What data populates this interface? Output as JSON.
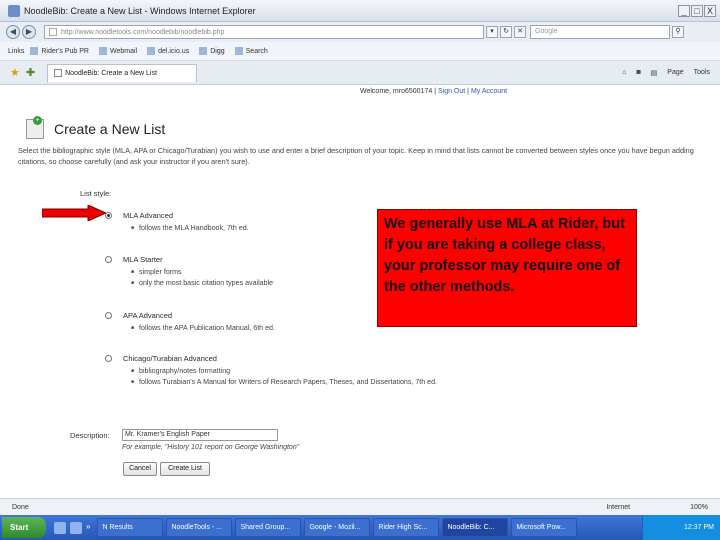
{
  "window": {
    "title": "NoodleBib: Create a New List - Windows Internet Explorer",
    "controls": [
      "_",
      "□",
      "X"
    ]
  },
  "address": {
    "url": "http://www.noodletools.com/noodlebib/noodlebib.php",
    "search_placeholder": "Google"
  },
  "links_bar": {
    "label": "Links",
    "items": [
      "Rider's Pub PR",
      "Webmail",
      "del.icio.us",
      "Digg",
      "Search"
    ]
  },
  "tab": {
    "label": "NoodleBib: Create a New List"
  },
  "toolbar_tools": [
    "Page",
    "Tools"
  ],
  "page": {
    "welcome_text": "Welcome, mro6500174",
    "sign_out": "Sign Out",
    "my_account": "My Account",
    "title": "Create a New List",
    "intro": "Select the bibliographic style (MLA, APA or Chicago/Turabian) you wish to use and enter a brief description of your topic. Keep in mind that lists cannot be converted between styles once you have begun adding citations, so choose carefully (and ask your instructor if you aren't sure).",
    "list_style_label": "List style:",
    "options": [
      {
        "name": "MLA Advanced",
        "selected": true,
        "bullets": [
          "follows the MLA Handbook, 7th ed."
        ]
      },
      {
        "name": "MLA Starter",
        "selected": false,
        "bullets": [
          "simpler forms",
          "only the most basic citation types available"
        ]
      },
      {
        "name": "APA Advanced",
        "selected": false,
        "bullets": [
          "follows the APA Publication Manual, 6th ed."
        ]
      },
      {
        "name": "Chicago/Turabian Advanced",
        "selected": false,
        "bullets": [
          "bibliography/notes formatting",
          "follows Turabian's A Manual for Writers of Research Papers, Theses, and Dissertations, 7th ed."
        ]
      }
    ],
    "description_label": "Description:",
    "description_value": "Mr. Kramer's English Paper",
    "description_hint": "For example, \"History 101 report on George Washington\"",
    "cancel_label": "Cancel",
    "create_label": "Create List"
  },
  "callout": {
    "text": "We generally use MLA at Rider, but if you are taking a college class, your professor may require one of the other methods.",
    "color": "#ff0000"
  },
  "status": {
    "left": "Done",
    "zone": "Internet",
    "zoom": "100%"
  },
  "taskbar": {
    "start": "Start",
    "tasks": [
      "N Results",
      "NoodleTools - ...",
      "Shared Group...",
      "Google - Mozil...",
      "Rider High Sc...",
      "NoodleBib: C...",
      "Microsoft Pow..."
    ],
    "clock": "12:37 PM"
  }
}
